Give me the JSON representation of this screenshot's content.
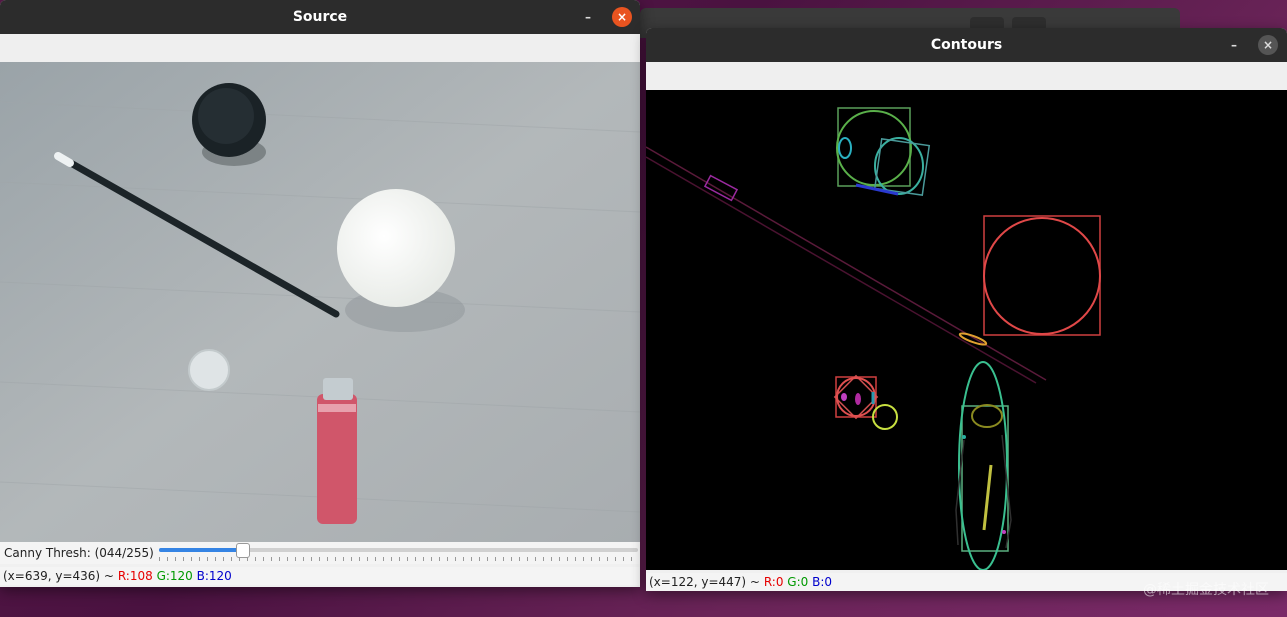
{
  "source_window": {
    "title": "Source",
    "trackbar": {
      "label": "Canny Thresh: (044/255)",
      "value": 44,
      "max": 255
    },
    "status": {
      "coords": "(x=639, y=436) ~",
      "r": "R:108",
      "g": "G:120",
      "b": "B:120"
    }
  },
  "contours_window": {
    "title": "Contours",
    "status": {
      "coords": "(x=122, y=447) ~",
      "r": "R:0",
      "g": "G:0",
      "b": "B:0"
    }
  },
  "window_controls": {
    "minimize": "–",
    "close": "×"
  },
  "watermark": "@稀土掘金技术社区",
  "colors": {
    "titlebar": "#2c2c2c",
    "close_button": "#e95420",
    "accent": "#3584e4"
  }
}
